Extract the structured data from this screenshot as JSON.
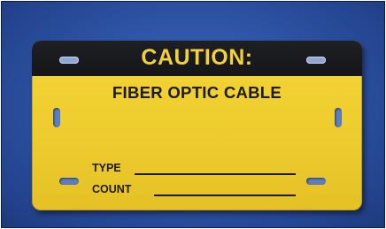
{
  "tag": {
    "header_text": "CAUTION:",
    "subtitle": "FIBER OPTIC CABLE",
    "fields": {
      "type_label": "TYPE",
      "count_label": "COUNT"
    }
  },
  "colors": {
    "background_blue": "#2f55a6",
    "tag_yellow": "#efcd2f",
    "header_black": "#15161a",
    "text_dark": "#1c1a14"
  }
}
